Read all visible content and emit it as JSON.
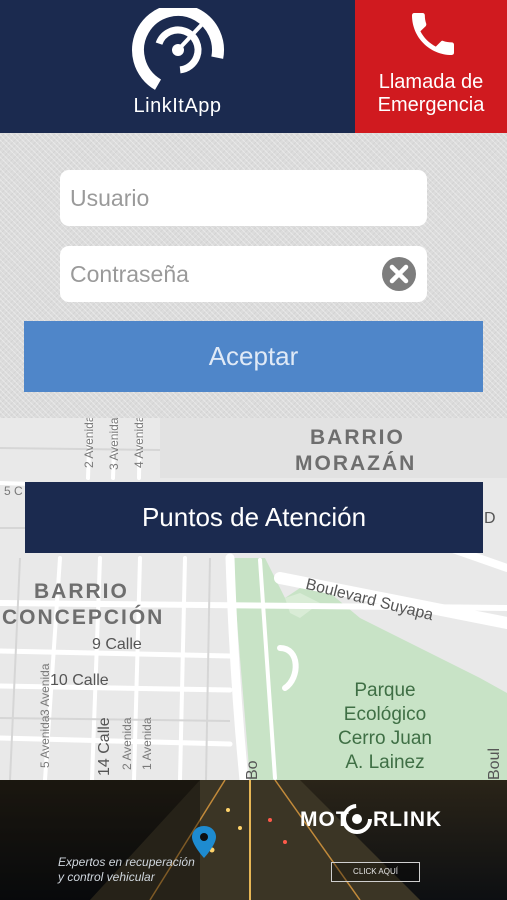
{
  "app": {
    "name": "LinkItApp",
    "logo_icon": "link-radar-logo-icon",
    "colors": {
      "brand": "#1b2a4f",
      "emergency": "#d01a1f",
      "accent": "#4f86c9"
    }
  },
  "emergency": {
    "icon": "phone-icon",
    "label_line1": "Llamada de",
    "label_line2": "Emergencia"
  },
  "login": {
    "username_placeholder": "Usuario",
    "password_placeholder": "Contraseña",
    "clear_icon": "clear-x-icon",
    "accept_label": "Aceptar"
  },
  "map": {
    "points_button_label": "Puntos de Atención",
    "labels": {
      "barrio_morazan_1": "BARRIO",
      "barrio_morazan_2": "MORAZÁN",
      "barrio_concepcion_1": "BARRIO",
      "barrio_concepcion_2": "CONCEPCIÓN",
      "boulevard_suyapa": "Boulevard Suyapa",
      "calle_9": "9 Calle",
      "calle_10": "10 Calle",
      "calle_14": "14 Calle",
      "avenida_1": "1 Avenida",
      "avenida_2": "2 Avenida",
      "avenida_3": "3 Avenida",
      "avenida_5": "5 Avenida",
      "avenida_top_1": "2 Avenida",
      "avenida_top_2": "3 Avenida",
      "avenida_top_3": "4 Avenida",
      "park_1": "Parque",
      "park_2": "Ecológico",
      "park_3": "Cerro Juan",
      "park_4": "A. Lainez",
      "edge_left": "5 C",
      "edge_right": "D",
      "edge_bottom_left": "Bo",
      "edge_bottom_right": "Boul"
    }
  },
  "banner": {
    "tagline_line1": "Expertos en recuperación",
    "tagline_line2": "y control vehicular",
    "brand_part1": "MOT",
    "brand_part2": "RLINK",
    "cta": "CLICK AQUÍ",
    "pin_icon": "location-pin-icon"
  }
}
